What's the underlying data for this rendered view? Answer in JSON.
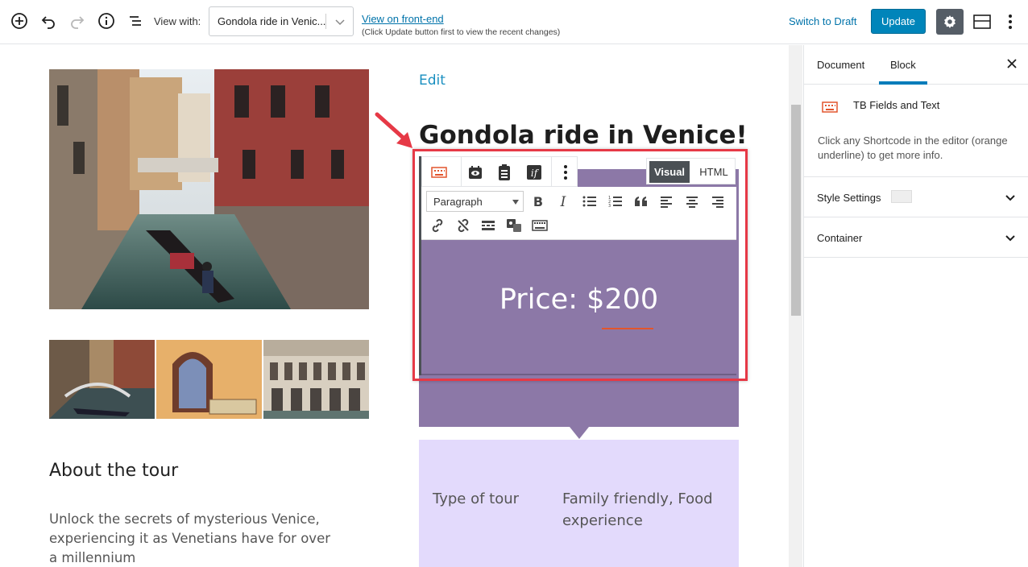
{
  "topbar": {
    "view_with_label": "View with:",
    "view_with_value": "Gondola ride in Venic...",
    "view_link": "View on front-end",
    "view_note": "(Click Update button first to view the recent changes)",
    "switch_draft": "Switch to Draft",
    "update": "Update"
  },
  "post": {
    "edit_link": "Edit",
    "title": "Gondola ride in Venice!",
    "price": "Price: $200",
    "about_heading": "About the tour",
    "about_text": "Unlock the secrets of mysterious Venice, experiencing it as Venetians have for over a millennium",
    "tour_label": "Type of tour",
    "tour_value": "Family friendly, Food experience"
  },
  "block_editor": {
    "format_select": "Paragraph",
    "tab_visual": "Visual",
    "tab_html": "HTML"
  },
  "sidebar": {
    "tab_document": "Document",
    "tab_block": "Block",
    "block_name": "TB Fields and Text",
    "block_desc": "Click any Shortcode in the editor (orange underline) to get more info.",
    "panel_style": "Style Settings",
    "panel_container": "Container"
  },
  "colors": {
    "accent": "#0085ba",
    "purple_block": "#8c78a7",
    "lavender_block": "#e3dafc",
    "highlight": "#e63946",
    "shortcode_underline": "#e2552d"
  }
}
